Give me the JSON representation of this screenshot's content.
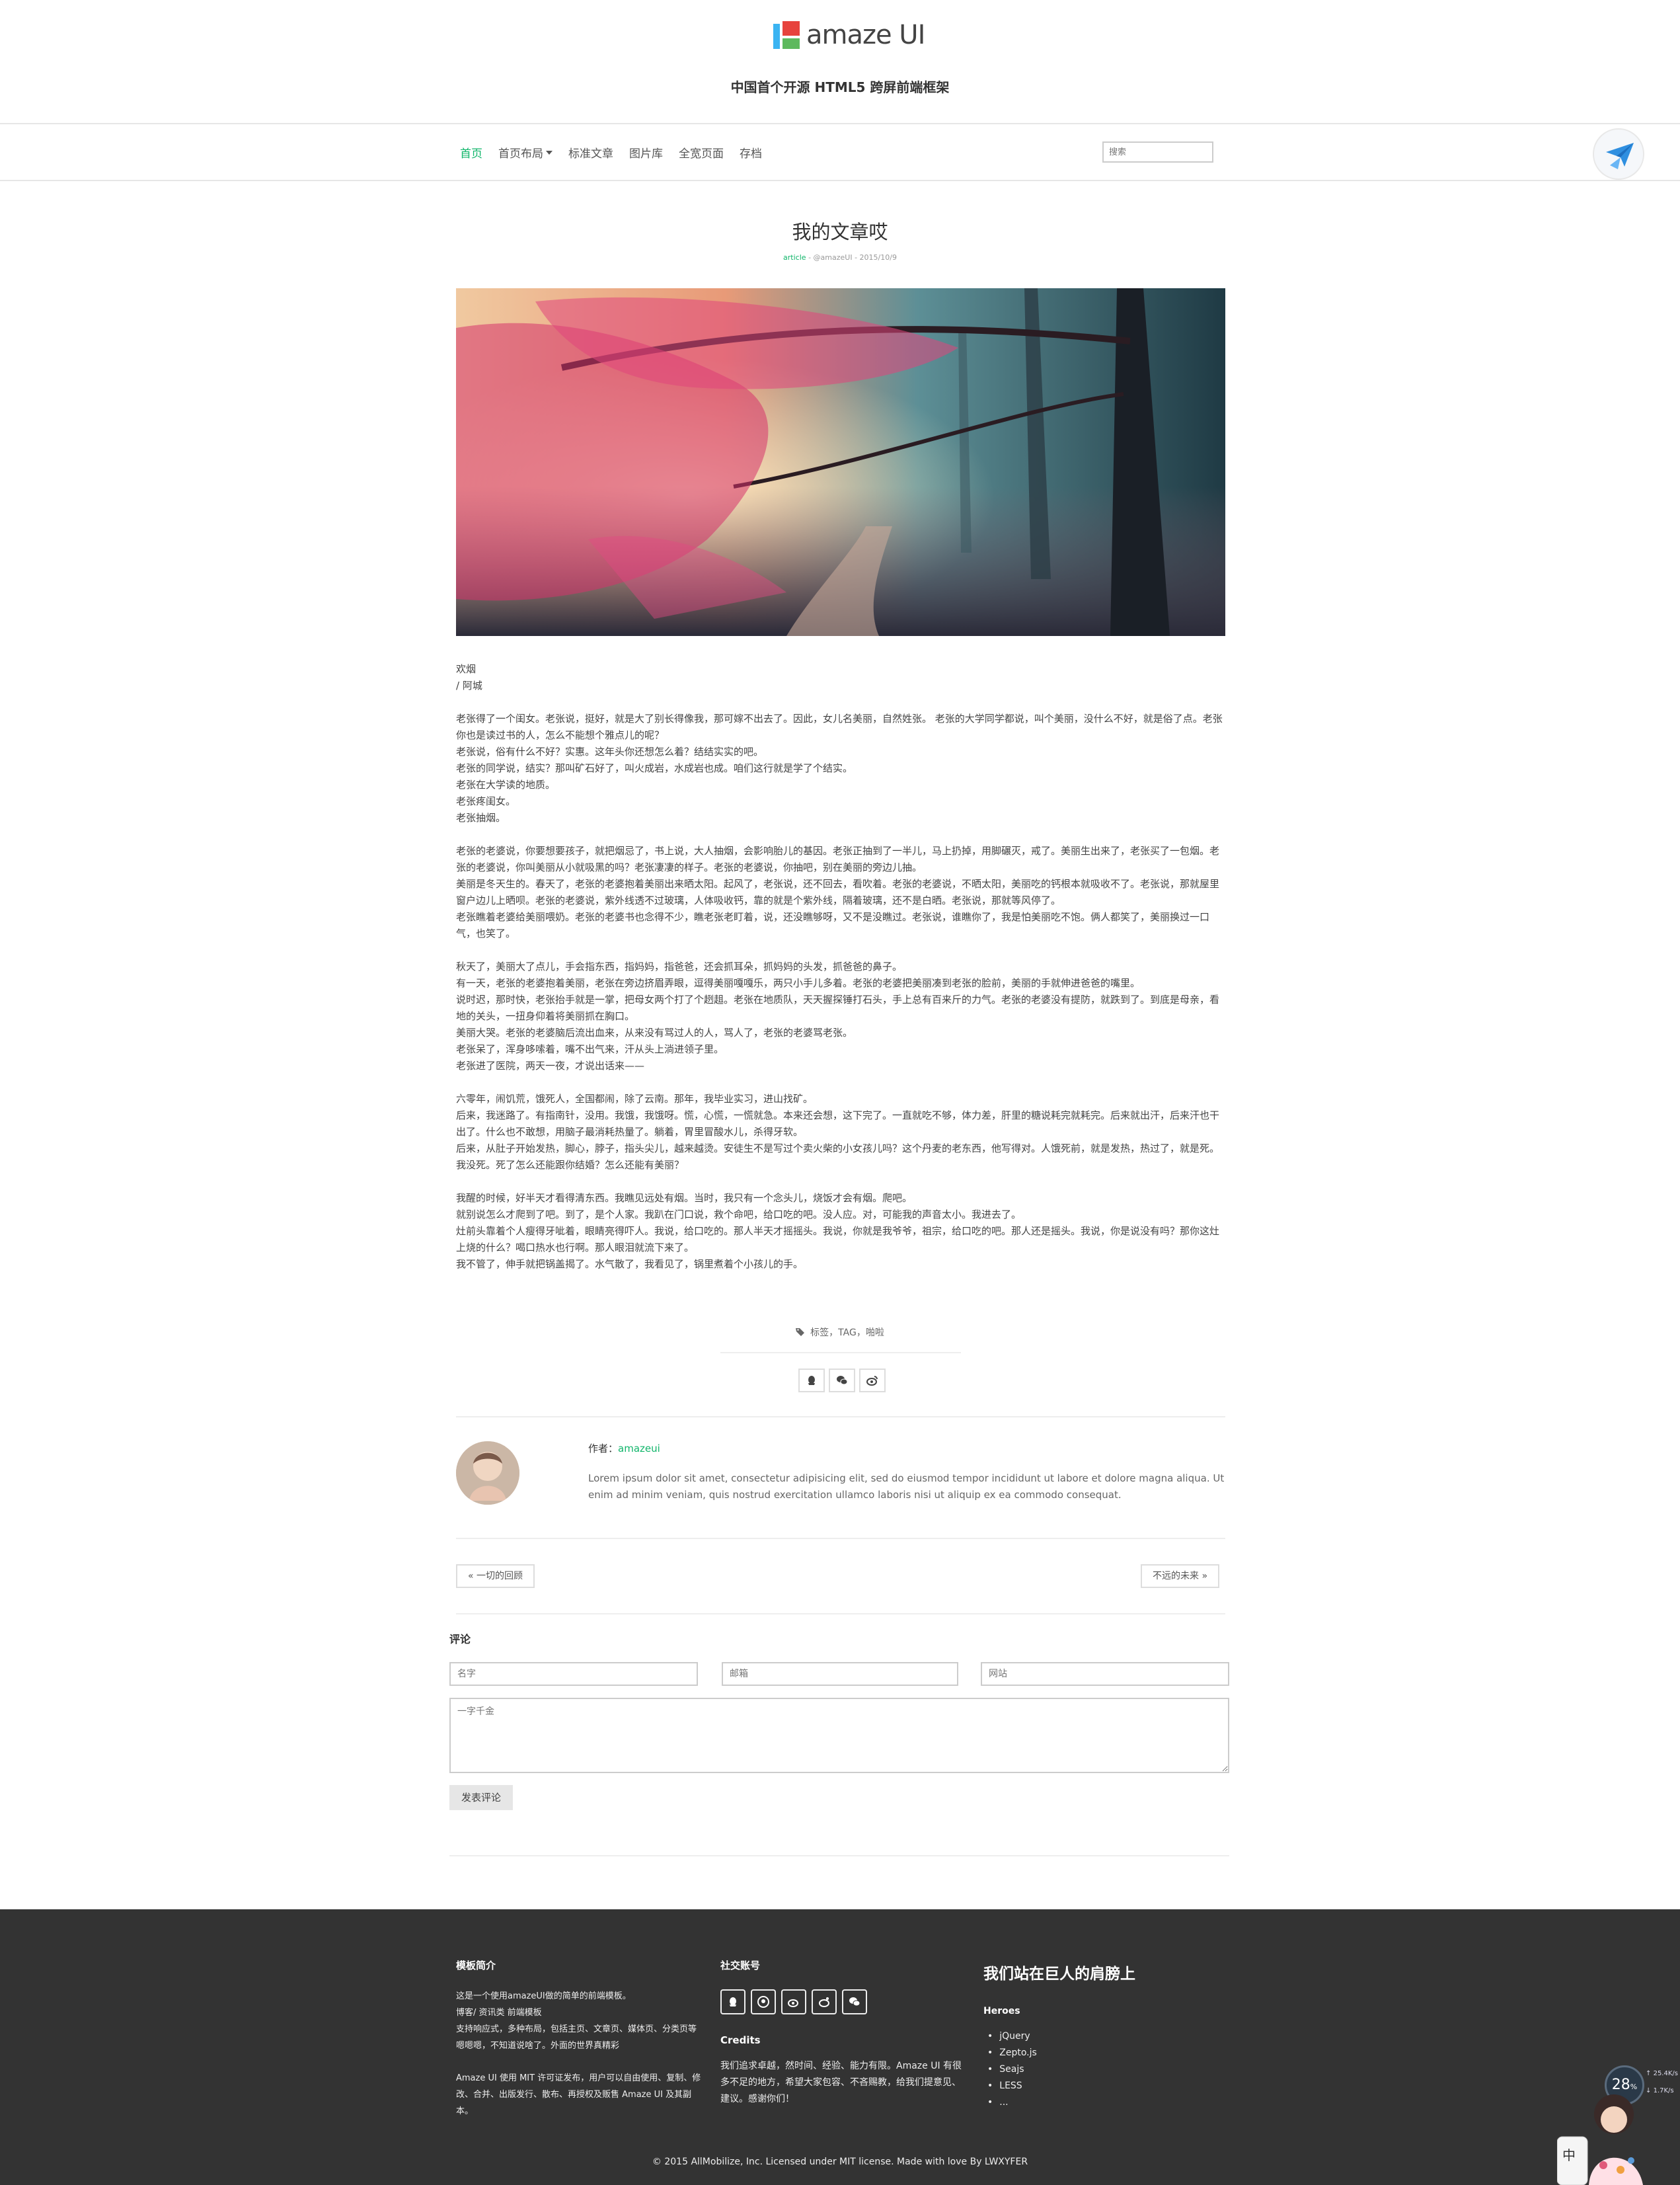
{
  "header": {
    "logo_text": "amaze UI",
    "slogan": "中国首个开源 HTML5 跨屏前端框架"
  },
  "nav": {
    "items": [
      "首页",
      "首页布局",
      "标准文章",
      "图片库",
      "全宽页面",
      "存档"
    ],
    "search_placeholder": "搜索"
  },
  "article": {
    "title": "我的文章哎",
    "meta_category": "article",
    "meta_author": "@amazeUI",
    "meta_date": "2015/10/9",
    "paragraphs": [
      "欢烟\n / 阿城",
      "老张得了一个闺女。老张说，挺好，就是大了别长得像我，那可嫁不出去了。因此，女儿名美丽，自然姓张。 老张的大学同学都说，叫个美丽，没什么不好，就是俗了点。老张你也是读过书的人，怎么不能想个雅点儿的呢？\n老张说，俗有什么不好？实惠。这年头你还想怎么着？结结实实的吧。\n老张的同学说，结实？那叫矿石好了，叫火成岩，水成岩也成。咱们这行就是学了个结实。\n老张在大学读的地质。\n老张疼闺女。\n老张抽烟。",
      "老张的老婆说，你要想要孩子，就把烟忌了，书上说，大人抽烟，会影响胎儿的基因。老张正抽到了一半儿，马上扔掉，用脚碾灭，戒了。美丽生出来了，老张买了一包烟。老张的老婆说，你叫美丽从小就吸黑的吗？老张凄凄的样子。老张的老婆说，你抽吧，别在美丽的旁边儿抽。\n美丽是冬天生的。春天了，老张的老婆抱着美丽出来晒太阳。起风了，老张说，还不回去，看吹着。老张的老婆说，不晒太阳，美丽吃的钙根本就吸收不了。老张说，那就屋里窗户边儿上晒呗。老张的老婆说，紫外线透不过玻璃，人体吸收钙，靠的就是个紫外线，隔着玻璃，还不是白晒。老张说，那就等风停了。\n老张瞧着老婆给美丽喂奶。老张的老婆书也念得不少，瞧老张老盯着，说，还没瞧够呀，又不是没瞧过。老张说，谁瞧你了，我是怕美丽吃不饱。俩人都笑了，美丽换过一口气，也笑了。",
      "秋天了，美丽大了点儿，手会指东西，指妈妈，指爸爸，还会抓耳朵，抓妈妈的头发，抓爸爸的鼻子。\n有一天，老张的老婆抱着美丽，老张在旁边挤眉弄眼，逗得美丽嘎嘎乐，两只小手儿多着。老张的老婆把美丽凑到老张的脸前，美丽的手就伸进爸爸的嘴里。\n说时迟，那时快，老张抬手就是一掌，把母女两个打了个趔趄。老张在地质队，天天握探锤打石头，手上总有百来斤的力气。老张的老婆没有提防，就跌到了。到底是母亲，看地的关头，一扭身仰着将美丽抓在胸口。\n美丽大哭。老张的老婆脑后流出血来，从来没有骂过人的人，骂人了，老张的老婆骂老张。\n老张呆了，浑身哆嗦着，嘴不出气来，汗从头上淌进领子里。\n老张进了医院，两天一夜，才说出话来——",
      "六零年，闹饥荒，饿死人，全国都闹，除了云南。那年，我毕业实习，进山找矿。\n后来，我迷路了。有指南针，没用。我饿，我饿呀。慌，心慌，一慌就急。本来还会想，这下完了。一直就吃不够，体力差，肝里的糖说耗完就耗完。后来就出汗，后来汗也干出了。什么也不敢想，用脑子最消耗热量了。躺着，胃里冒酸水儿，杀得牙软。\n后来，从肚子开始发热，脚心，脖子，指头尖儿，越来越烫。安徒生不是写过个卖火柴的小女孩儿吗？这个丹麦的老东西，他写得对。人饿死前，就是发热，热过了，就是死。\n我没死。死了怎么还能跟你结婚？怎么还能有美丽？",
      "我醒的时候，好半天才看得清东西。我瞧见远处有烟。当时，我只有一个念头儿，烧饭才会有烟。爬吧。\n就别说怎么才爬到了吧。到了，是个人家。我趴在门口说，救个命吧，给口吃的吧。没人应。对，可能我的声音太小。我进去了。\n灶前头靠着个人瘦得牙呲着，眼睛亮得吓人。我说，给口吃的。那人半天才摇摇头。我说，你就是我爷爷，祖宗，给口吃的吧。那人还是摇头。我说，你是说没有吗？那你这灶上烧的什么？喝口热水也行啊。那人眼泪就流下来了。\n我不管了，伸手就把锅盖揭了。水气散了，我看见了，锅里煮着个小孩儿的手。"
    ]
  },
  "tags": {
    "text": "标签，TAG，啪啦"
  },
  "share": {
    "icons": [
      "qq-icon",
      "wechat-icon",
      "weibo-icon"
    ]
  },
  "author": {
    "label": "作者：",
    "name": "amazeui",
    "bio": "Lorem ipsum dolor sit amet, consectetur adipisicing elit, sed do eiusmod tempor incididunt ut labore et dolore magna aliqua. Ut enim ad minim veniam, quis nostrud exercitation ullamco laboris nisi ut aliquip ex ea commodo consequat."
  },
  "pager": {
    "prev": "« 一切的回顾",
    "next": "不远的未来 »"
  },
  "comments": {
    "title": "评论",
    "name_placeholder": "名字",
    "email_placeholder": "邮箱",
    "website_placeholder": "网站",
    "message_placeholder": "一字千金",
    "submit_label": "发表评论"
  },
  "footer": {
    "intro_title": "模板简介",
    "intro_lines": "这是一个使用amazeUI做的简单的前端模板。\n博客/ 资讯类 前端模板\n支持响应式，多种布局，包括主页、文章页、媒体页、分类页等\n嗯嗯嗯，不知道说啥了。外面的世界真精彩",
    "license_text": "Amaze UI 使用 MIT 许可证发布，用户可以自由使用、复制、修改、合并、出版发行、散布、再授权及贩售 Amaze UI 及其副本。",
    "social_title": "社交账号",
    "social_icons": [
      "qq-icon",
      "github-icon",
      "weibo-icon",
      "reddit-icon",
      "wechat-icon"
    ],
    "credits_title": "Credits",
    "credits_text": "我们追求卓越，然时间、经验、能力有限。Amaze UI 有很多不足的地方，希望大家包容、不吝赐教，给我们提意见、建议。感谢你们！",
    "giants_title": "我们站在巨人的肩膀上",
    "heroes_title": "Heroes",
    "heroes": [
      "jQuery",
      "Zepto.js",
      "Seajs",
      "LESS",
      "..."
    ],
    "copyright": "© 2015 AllMobilize, Inc. Licensed under MIT license. Made with love By LWXYFER"
  },
  "widget": {
    "speed_value": "28",
    "speed_unit": "%",
    "upload": "25.4",
    "upload_unit": "K/s",
    "download": "1.7",
    "download_unit": "K/s",
    "mascot_text": "中"
  },
  "colors": {
    "accent": "#10b56a",
    "footer_bg": "#333333"
  }
}
